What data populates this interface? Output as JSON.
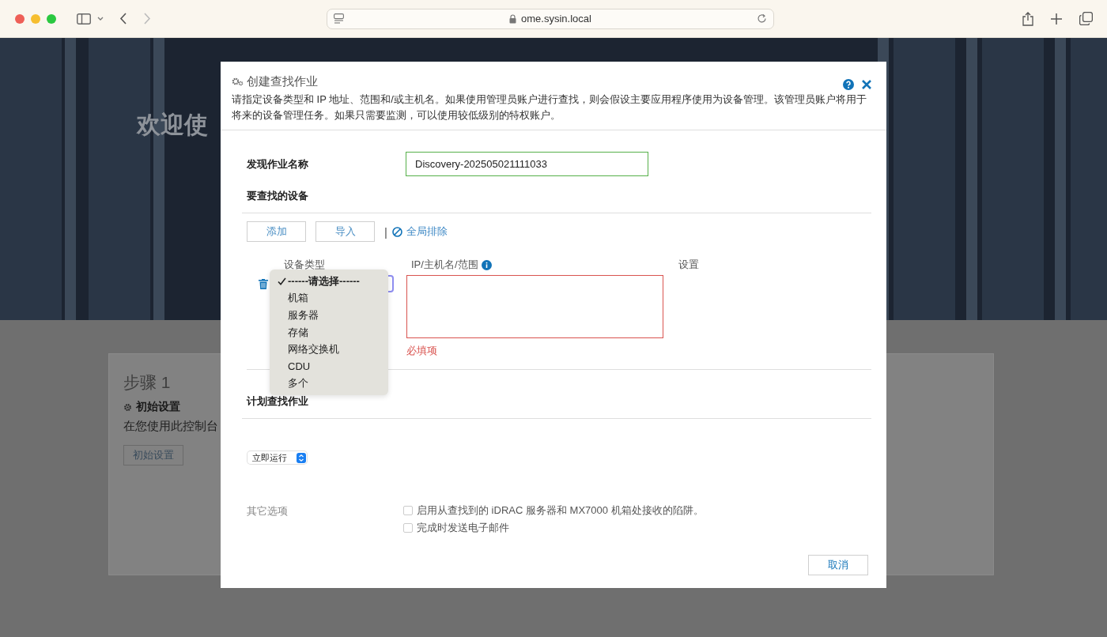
{
  "browser": {
    "url": "ome.sysin.local"
  },
  "background": {
    "hero_title": "欢迎使",
    "step": {
      "title": "步骤 1",
      "heading": "初始设置",
      "text": "在您使用此控制台",
      "button": "初始设置"
    }
  },
  "dialog": {
    "title": "创建查找作业",
    "description": "请指定设备类型和 IP 地址、范围和/或主机名。如果使用管理员账户进行查找，则会假设主要应用程序使用为设备管理。该管理员账户将用于将来的设备管理任务。如果只需要监测，可以使用较低级别的特权账户。",
    "job_name": {
      "label": "发现作业名称",
      "value": "Discovery-202505021111033"
    },
    "devices": {
      "title": "要查找的设备",
      "buttons": [
        "添加",
        "导入"
      ],
      "separator": "|",
      "exclude_link": "全局排除",
      "columns": [
        "设备类型",
        "IP/主机名/范围",
        "设置"
      ],
      "type_options": [
        {
          "label": "------请选择------",
          "selected": true
        },
        {
          "label": "机箱",
          "selected": false
        },
        {
          "label": "服务器",
          "selected": false
        },
        {
          "label": "存储",
          "selected": false
        },
        {
          "label": "网络交换机",
          "selected": false
        },
        {
          "label": "CDU",
          "selected": false
        },
        {
          "label": "多个",
          "selected": false
        }
      ],
      "ip_error": "必填项"
    },
    "schedule": {
      "title": "计划查找作业",
      "run": "立即运行"
    },
    "other": {
      "label": "其它选项",
      "options": [
        {
          "label": "启用从查找到的 iDRAC 服务器和 MX7000 机箱处接收的陷阱。",
          "checked": false
        },
        {
          "label": "完成时发送电子邮件",
          "checked": false
        }
      ]
    },
    "cancel": "取消"
  }
}
